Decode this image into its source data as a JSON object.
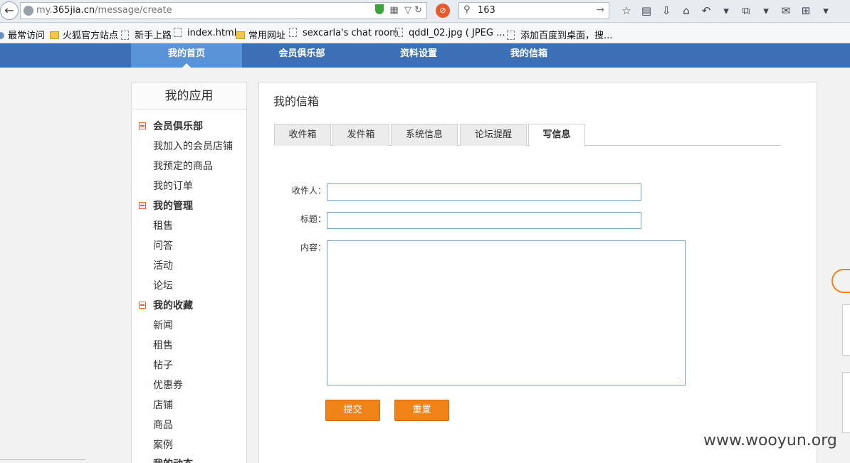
{
  "browser": {
    "url_prefix": "my.",
    "url_domain": "365jia.cn",
    "url_path": "/message/create",
    "search_value": "163"
  },
  "bookmarks": [
    "最常访问",
    "火狐官方站点",
    "新手上路",
    "index.html",
    "常用网址",
    "sexcarla's chat room",
    "qddl_02.jpg ( JPEG ...",
    "添加百度到桌面，搜..."
  ],
  "nav": {
    "items": [
      "我的首页",
      "会员俱乐部",
      "资料设置",
      "我的信箱"
    ]
  },
  "sidebar": {
    "title": "我的应用",
    "groups": [
      {
        "label": "会员俱乐部",
        "items": [
          "我加入的会员店铺",
          "我预定的商品",
          "我的订单"
        ]
      },
      {
        "label": "我的管理",
        "items": [
          "租售",
          "问答",
          "活动",
          "论坛"
        ]
      },
      {
        "label": "我的收藏",
        "items": [
          "新闻",
          "租售",
          "帖子",
          "优惠券",
          "店铺",
          "商品",
          "案例"
        ]
      }
    ],
    "cut_off_item": "我的动态"
  },
  "main": {
    "title": "我的信箱",
    "tabs": [
      "收件箱",
      "发件箱",
      "系统信息",
      "论坛提醒",
      "写信息"
    ],
    "active_tab": "写信息",
    "form": {
      "recipient_label": "收件人：",
      "subject_label": "标题：",
      "content_label": "内容：",
      "recipient_value": "",
      "subject_value": "",
      "content_value": "",
      "submit_label": "提交",
      "reset_label": "重置"
    }
  },
  "watermark": "www.wooyun.org",
  "colors": {
    "nav_bg": "#3b6fb6",
    "nav_active": "#5b93d8",
    "button": "#f08418",
    "input_border": "#7b9fc4"
  }
}
